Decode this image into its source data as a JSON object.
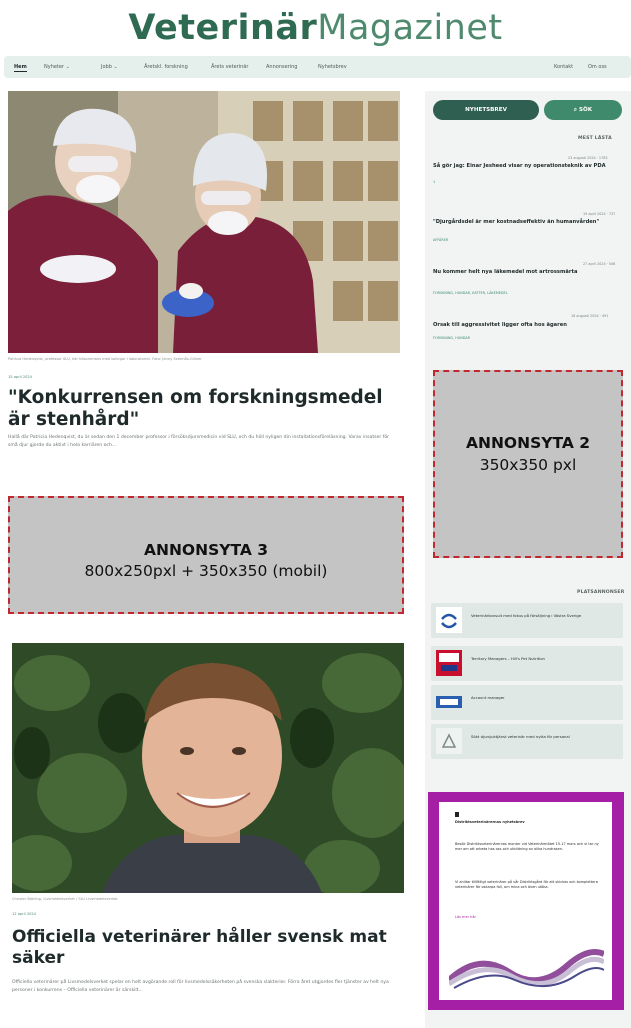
{
  "logo": {
    "part1": "Veterinär",
    "part2": "Magazinet"
  },
  "nav": {
    "items": [
      "Hem",
      "Nyheter ⌄",
      "Jobb ⌄",
      "Åretskl. forskning",
      "Årets veterinär",
      "Annonsering",
      "Nyhetsbrev"
    ],
    "right_items": [
      "Kontakt",
      "Om oss"
    ]
  },
  "article1": {
    "caption": "Patricia Hedenqvist, professor SLU, här tillsammans med kollegor i laboratoriet. Foto: Jenny Svennås-Gillner",
    "date": "15 april 2024",
    "title": "\"Konkurrensen om forskningsmedel är stenhård\"",
    "excerpt": "Hallå där Patricia Hedenqvist, du är sedan den 1 december professor i försöksdjursmedicin vid SLU, och du höll nyligen din installationsföreläsning. Varav insatser för små djur gjorde du aktivt i hela karriären och..."
  },
  "ad3": {
    "title": "ANNONSYTA 3",
    "subtitle": "800x250pxl + 350x350 (mobil)"
  },
  "ad2": {
    "title": "ANNONSYTA 2",
    "subtitle": "350x350 pxl"
  },
  "article2": {
    "caption": "Christer Björling, Livsmedelsverket / SLU Livsmedelsverket",
    "date": "12 april 2024",
    "title": "Officiella veterinärer håller svensk mat säker",
    "excerpt": "Officiella veterinärer på Livsmedelsverket spelar en helt avgörande roll för livsmedelssäkerheten på svenska slakterier. Förra året utgjordes fler tjänster av helt nya personer i konkurrens – Officiella veterinärer är särskilt..."
  },
  "sidebar": {
    "newsletter_label": "NYHETSBREV",
    "search_label": "SÖK",
    "most_read_title": "MEST LÄSTA",
    "most_read": [
      {
        "meta": "23 augusti 2024 · 1783",
        "title": "Så gör jag: Einar Jesheed visar ny operationsteknik av PDA",
        "tag": "1"
      },
      {
        "meta": "19 april 2024 · 737",
        "title": "\"Djurgårdsdel är mer kostnadseffektiv än humanvården\"",
        "tag": "AFFÄRER"
      },
      {
        "meta": "27 april 2024 · 546",
        "title": "Nu kommer helt nya läkemedel mot artrossmärta",
        "tag": "FORSKNING, HUNDAR, KATTER, LÄKEMEDEL"
      },
      {
        "meta": "18 augusti 2024 · 491",
        "title": "Orsak till aggressivitet ligger ofta hos ägaren",
        "tag": "FORSKNING, HUNDAR"
      }
    ],
    "jobs_title": "PLATSANNONSER",
    "jobs": [
      "Veterinärkonsult med fokus på försäljning i Västra Sverige",
      "Territory Managers – Hill's Pet Nutrition",
      "Account manager",
      "Sökt djursjuktjänst veterinär med nytta för personal"
    ]
  },
  "promo": {
    "brand": "Distriktsveterinärernas nyhetsbrev",
    "text1": "Besök Distriktsveterinärernas monter vid Veterinärmötet 15-17 mars och vi tar ny mer om att arbeta hos oss och utbildning av olika hundrasen.",
    "text2": "Vi anlitar tillfälligt veterinärer på vår Distriktsgård för att skickas och komplettera veterinärer för oskarpa fall, om mina och även utöka.",
    "link": "Läs mer här"
  }
}
